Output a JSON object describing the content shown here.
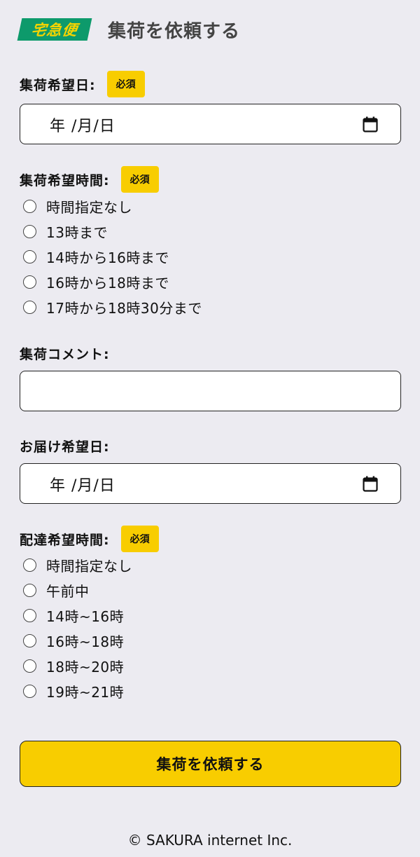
{
  "header": {
    "brand": "宅急便",
    "title": "集荷を依頼する"
  },
  "pickup_date": {
    "label": "集荷希望日:",
    "required": "必須",
    "value": "年 /月/日"
  },
  "pickup_time": {
    "label": "集荷希望時間:",
    "required": "必須",
    "options": [
      "時間指定なし",
      "13時まで",
      "14時から16時まで",
      "16時から18時まで",
      "17時から18時30分まで"
    ]
  },
  "pickup_comment": {
    "label": "集荷コメント:",
    "value": ""
  },
  "delivery_date": {
    "label": "お届け希望日:",
    "value": "年 /月/日"
  },
  "delivery_time": {
    "label": "配達希望時間:",
    "required": "必須",
    "options": [
      "時間指定なし",
      "午前中",
      "14時~16時",
      "16時~18時",
      "18時~20時",
      "19時~21時"
    ]
  },
  "submit_label": "集荷を依頼する",
  "footer": "© SAKURA internet Inc.",
  "colors": {
    "accent": "#f8cd00",
    "brand_bg": "#0d9a6b",
    "background": "#ecebf1"
  }
}
